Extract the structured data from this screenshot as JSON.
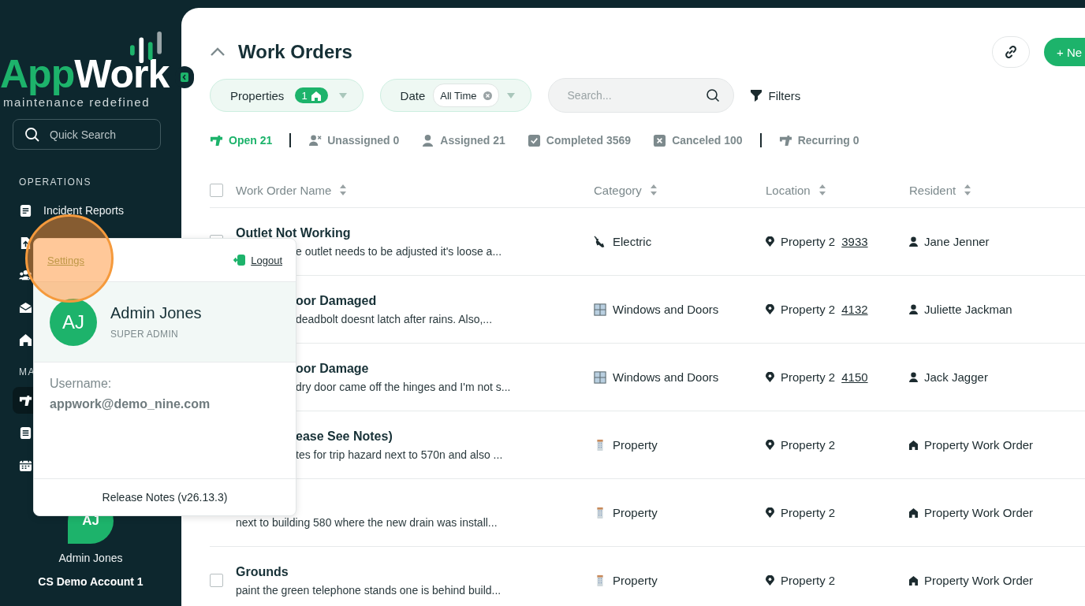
{
  "sidebar": {
    "logo": {
      "text_1": "App",
      "text_2": "Work",
      "tagline": "maintenance redefined"
    },
    "search": {
      "placeholder": "Quick Search"
    },
    "sections": [
      {
        "heading": "OPERATIONS",
        "items": [
          {
            "kind": "report",
            "label": "Incident Reports",
            "selected": false
          },
          {
            "kind": "upload",
            "selected": false
          },
          {
            "kind": "people",
            "selected": false
          },
          {
            "kind": "mail",
            "selected": false
          },
          {
            "kind": "home",
            "selected": false
          }
        ]
      },
      {
        "heading": "MA",
        "items": [
          {
            "kind": "tool",
            "selected": true
          },
          {
            "kind": "doc",
            "selected": false
          },
          {
            "kind": "calendar",
            "selected": false
          }
        ]
      }
    ],
    "user": {
      "initials": "AJ",
      "name": "Admin Jones",
      "account": "CS Demo Account 1"
    }
  },
  "header": {
    "title": "Work Orders",
    "new_button": "+ Ne"
  },
  "filters": {
    "properties": {
      "label": "Properties",
      "count": "1"
    },
    "date": {
      "label": "Date",
      "value": "All Time"
    },
    "search": {
      "placeholder": "Search..."
    },
    "filters_button": "Filters"
  },
  "status_tabs": [
    {
      "kind": "open",
      "label": "Open 21",
      "selected": true
    },
    {
      "kind": "separator"
    },
    {
      "kind": "unassigned",
      "label": "Unassigned 0",
      "selected": false
    },
    {
      "kind": "assigned",
      "label": "Assigned 21",
      "selected": false
    },
    {
      "kind": "completed",
      "label": "Completed 3569",
      "selected": false
    },
    {
      "kind": "canceled",
      "label": "Canceled 100",
      "selected": false
    },
    {
      "kind": "separator"
    },
    {
      "kind": "recurring",
      "label": "Recurring 0",
      "selected": false
    }
  ],
  "table": {
    "select_all": {
      "checked": false
    },
    "columns": [
      "Work Order Name",
      "Category",
      "Location",
      "Resident"
    ],
    "rows": [
      {
        "kind": "description_covered",
        "checked": false,
        "name": "Outlet Not Working",
        "description": "e outlet needs to be adjusted it's loose a...",
        "category": {
          "kind": "electric",
          "label": "Electric"
        },
        "location": "Property 2",
        "unit": "3933",
        "resident": {
          "kind": "person",
          "label": "Jane Jenner"
        }
      },
      {
        "kind": "covered",
        "name": "oor Damaged",
        "description": "deadbolt doesnt latch after rains. Also,...",
        "category": {
          "kind": "window",
          "label": "Windows and Doors"
        },
        "location": "Property 2",
        "unit": "4132",
        "resident": {
          "kind": "person",
          "label": "Juliette Jackman"
        }
      },
      {
        "kind": "covered",
        "name": "oor Damage",
        "description": "dry door came off the hinges and I'm not s...",
        "category": {
          "kind": "window",
          "label": "Windows and Doors"
        },
        "location": "Property 2",
        "unit": "4150",
        "resident": {
          "kind": "person",
          "label": "Jack Jagger"
        }
      },
      {
        "kind": "covered",
        "name": "ease See Notes)",
        "description": "tes for trip hazard next to 570n and also ...",
        "category": {
          "kind": "property",
          "label": "Property"
        },
        "location": "Property 2",
        "resident": {
          "kind": "property",
          "label": "Property Work Order"
        }
      },
      {
        "kind": "top_covered",
        "description": "next to building 580 where the new drain was install...",
        "category": {
          "kind": "property",
          "label": "Property"
        },
        "location": "Property 2",
        "resident": {
          "kind": "property",
          "label": "Property Work Order"
        }
      },
      {
        "kind": "plain",
        "checked": false,
        "name": "Grounds",
        "description": "paint the green telephone stands one is behind build...",
        "category": {
          "kind": "property",
          "label": "Property"
        },
        "location": "Property 2",
        "resident": {
          "kind": "property",
          "label": "Property Work Order"
        }
      }
    ]
  },
  "user_menu": {
    "settings": "Settings",
    "logout": "Logout",
    "initials": "AJ",
    "name": "Admin Jones",
    "role": "SUPER ADMIN",
    "username_label": "Username:",
    "username": "appwork@demo_nine.com",
    "release_notes": "Release Notes (v26.13.3)"
  }
}
